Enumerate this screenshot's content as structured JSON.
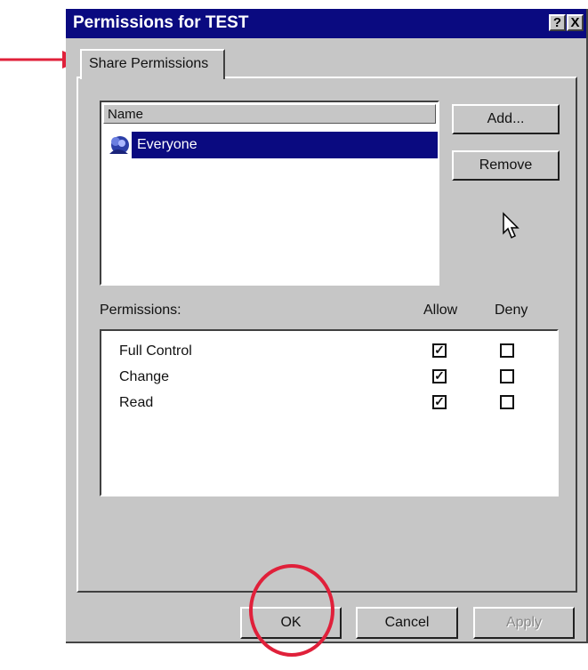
{
  "window": {
    "title": "Permissions for TEST",
    "help_button": "?",
    "close_button": "X"
  },
  "tab": {
    "label": "Share Permissions"
  },
  "names_list": {
    "header": "Name",
    "items": [
      {
        "label": "Everyone",
        "icon": "group-icon",
        "selected": true
      }
    ]
  },
  "side_buttons": {
    "add_label": "Add...",
    "remove_label": "Remove"
  },
  "permissions": {
    "label": "Permissions:",
    "allow_header": "Allow",
    "deny_header": "Deny",
    "rows": [
      {
        "name": "Full Control",
        "allow": true,
        "deny": false
      },
      {
        "name": "Change",
        "allow": true,
        "deny": false
      },
      {
        "name": "Read",
        "allow": true,
        "deny": false
      }
    ]
  },
  "footer": {
    "ok_label": "OK",
    "cancel_label": "Cancel",
    "apply_label": "Apply"
  },
  "colors": {
    "titlebar": "#0a0a80",
    "face": "#c6c6c6",
    "annotation": "#e0203a"
  }
}
